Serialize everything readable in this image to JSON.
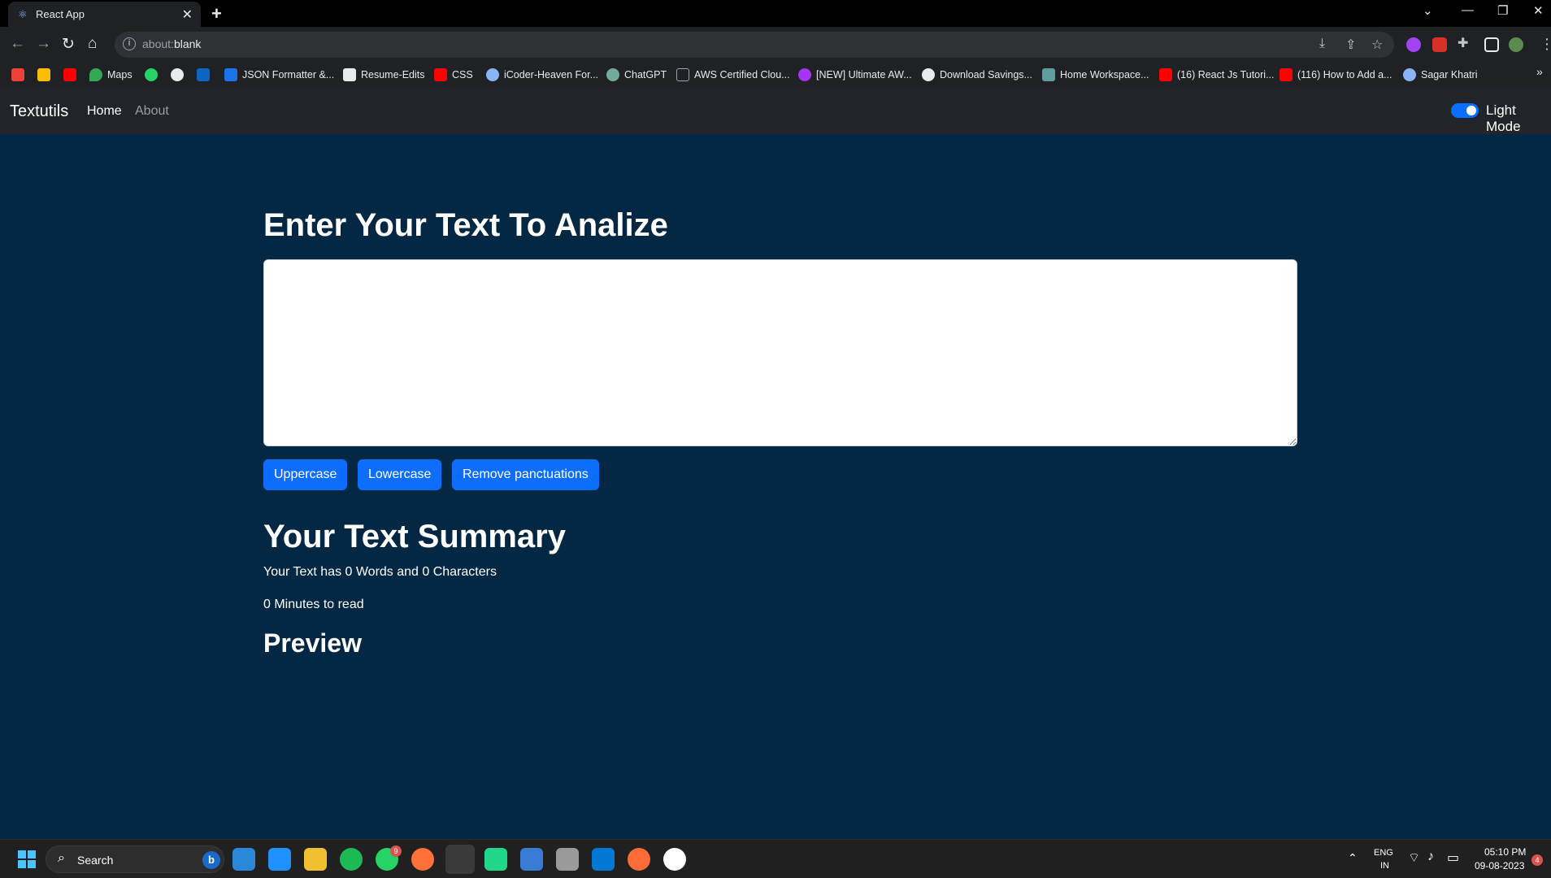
{
  "browser": {
    "tab_title": "React App",
    "url_prefix": "about:",
    "url_main": "blank",
    "bookmarks": [
      {
        "label": "",
        "icon": "gmail-icon",
        "color": "#ea4335"
      },
      {
        "label": "",
        "icon": "drive-icon",
        "color": "#fbbc04"
      },
      {
        "label": "",
        "icon": "youtube-icon",
        "color": "#ff0000"
      },
      {
        "label": "Maps",
        "icon": "maps-icon",
        "color": "#34a853"
      },
      {
        "label": "",
        "icon": "whatsapp-icon",
        "color": "#25d366"
      },
      {
        "label": "",
        "icon": "github-icon",
        "color": "#e8eaed"
      },
      {
        "label": "",
        "icon": "linkedin-icon",
        "color": "#0a66c2"
      },
      {
        "label": "JSON Formatter &...",
        "icon": "check-icon",
        "color": "#1a73e8"
      },
      {
        "label": "Resume-Edits",
        "icon": "play-icon",
        "color": "#e8eaed"
      },
      {
        "label": "CSS",
        "icon": "youtube-icon",
        "color": "#ff0000"
      },
      {
        "label": "iCoder-Heaven For...",
        "icon": "code-icon",
        "color": "#8ab4f8"
      },
      {
        "label": "ChatGPT",
        "icon": "chatgpt-icon",
        "color": "#74aa9c"
      },
      {
        "label": "AWS Certified Clou...",
        "icon": "bracket-icon",
        "color": "#9aa0a6"
      },
      {
        "label": "[NEW] Ultimate AW...",
        "icon": "udemy-icon",
        "color": "#a435f0"
      },
      {
        "label": "Download Savings...",
        "icon": "globe-icon",
        "color": "#e8eaed"
      },
      {
        "label": "Home Workspace...",
        "icon": "workspace-icon",
        "color": "#5f9ea0"
      },
      {
        "label": "(16) React Js Tutori...",
        "icon": "youtube-icon",
        "color": "#ff0000"
      },
      {
        "label": "(116) How to Add a...",
        "icon": "youtube-icon",
        "color": "#ff0000"
      },
      {
        "label": "Sagar Khatri",
        "icon": "person-icon",
        "color": "#8ab4f8"
      }
    ]
  },
  "app": {
    "brand": "Textutils",
    "nav": {
      "home": "Home",
      "about": "About"
    },
    "mode_label": "Light Mode",
    "heading": "Enter Your Text To Analize",
    "textarea_value": "",
    "buttons": {
      "uppercase": "Uppercase",
      "lowercase": "Lowercase",
      "remove": "Remove panctuations"
    },
    "summary_heading": "Your Text Summary",
    "summary_line": "Your Text has 0 Words and 0 Characters",
    "read_time": "0 Minutes to read",
    "preview_heading": "Preview"
  },
  "taskbar": {
    "search_label": "Search",
    "whatsapp_badge": "9",
    "lang_top": "ENG",
    "lang_bottom": "IN",
    "time": "05:10 PM",
    "date": "09-08-2023",
    "notification_count": "4"
  },
  "colors": {
    "page_bg": "#042743",
    "navbar_bg": "#212529",
    "button": "#0d6efd"
  }
}
